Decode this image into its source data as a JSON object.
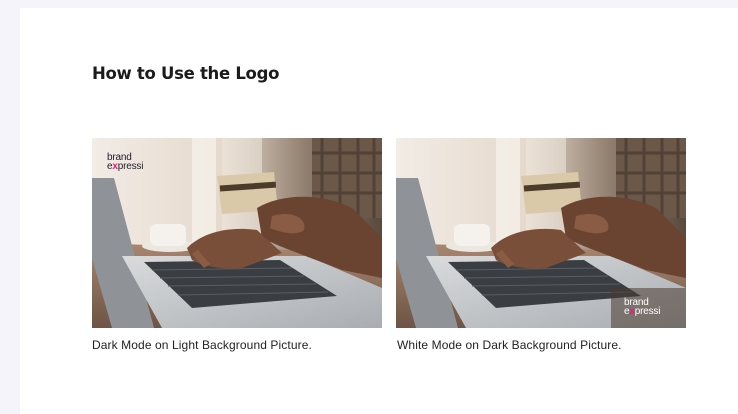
{
  "section": {
    "heading": "How to Use the Logo"
  },
  "examples": [
    {
      "caption": "Dark Mode on Light Background Picture.",
      "logo": {
        "line1": "brand",
        "line2_prefix": "e",
        "line2_accent": "x",
        "line2_suffix": "pressi",
        "color": "#1f1f2a"
      }
    },
    {
      "caption": "White Mode on Dark Background Picture.",
      "logo": {
        "line1": "brand",
        "line2_prefix": "e",
        "line2_accent": "x",
        "line2_suffix": "pressi",
        "color": "#ffffff"
      }
    }
  ],
  "colors": {
    "page_background": "#f6f4fb",
    "card_background": "#ffffff",
    "logo_accent": "#e21e7a"
  }
}
